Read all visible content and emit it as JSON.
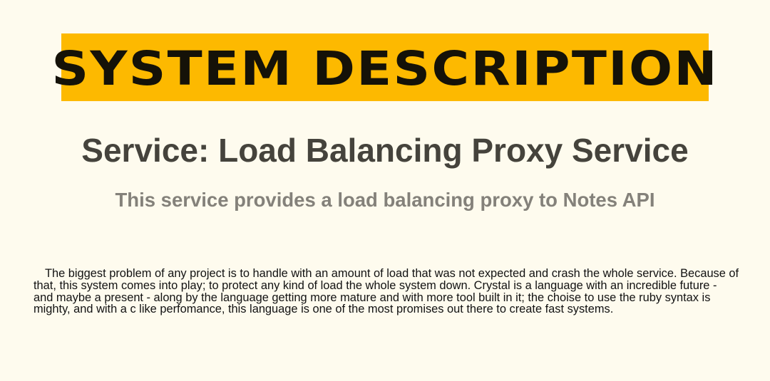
{
  "header": {
    "title": "SYSTEM DESCRIPTION"
  },
  "service": {
    "heading": "Service: Load Balancing Proxy Service",
    "subtitle": "This service provides a load balancing proxy to Notes API"
  },
  "description": {
    "text": "The biggest problem of any project is to handle with an amount of load that was not expected and crash the whole service. Because of that, this system comes into play; to protect any kind of load the whole system down. Crystal is a language with an incredible future - and maybe a present - along by the language getting more mature and with more tool built in it; the choise to use the ruby syntax is mighty, and with a c like perfomance, this language is one of the most promises out there to create fast systems."
  },
  "colors": {
    "background": "#fefbee",
    "banner": "#fdb900",
    "title_text": "#151208",
    "heading_text": "#45433c",
    "subtitle_text": "#84817a",
    "body_text": "#121212"
  }
}
